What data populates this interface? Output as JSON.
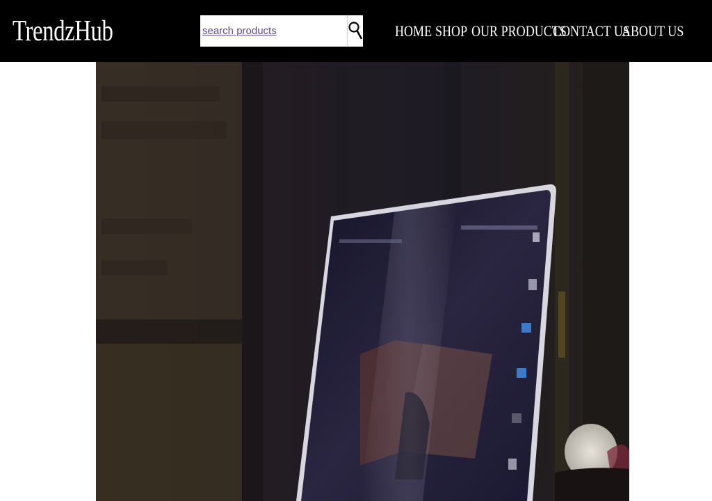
{
  "brand": {
    "name": "TrendzHub"
  },
  "search": {
    "placeholder": "search products",
    "value": ""
  },
  "icons": {
    "search": "search-icon"
  },
  "nav": {
    "items": [
      {
        "label": "HOME"
      },
      {
        "label": "SHOP"
      },
      {
        "label": "OUR PRODUCTS"
      },
      {
        "label": "CONTACT US"
      },
      {
        "label": "ABOUT US"
      }
    ]
  },
  "colors": {
    "navbar_bg": "#000000",
    "nav_text": "#ffffff",
    "page_bg": "#ffffff",
    "search_placeholder": "#5a4a8c"
  }
}
